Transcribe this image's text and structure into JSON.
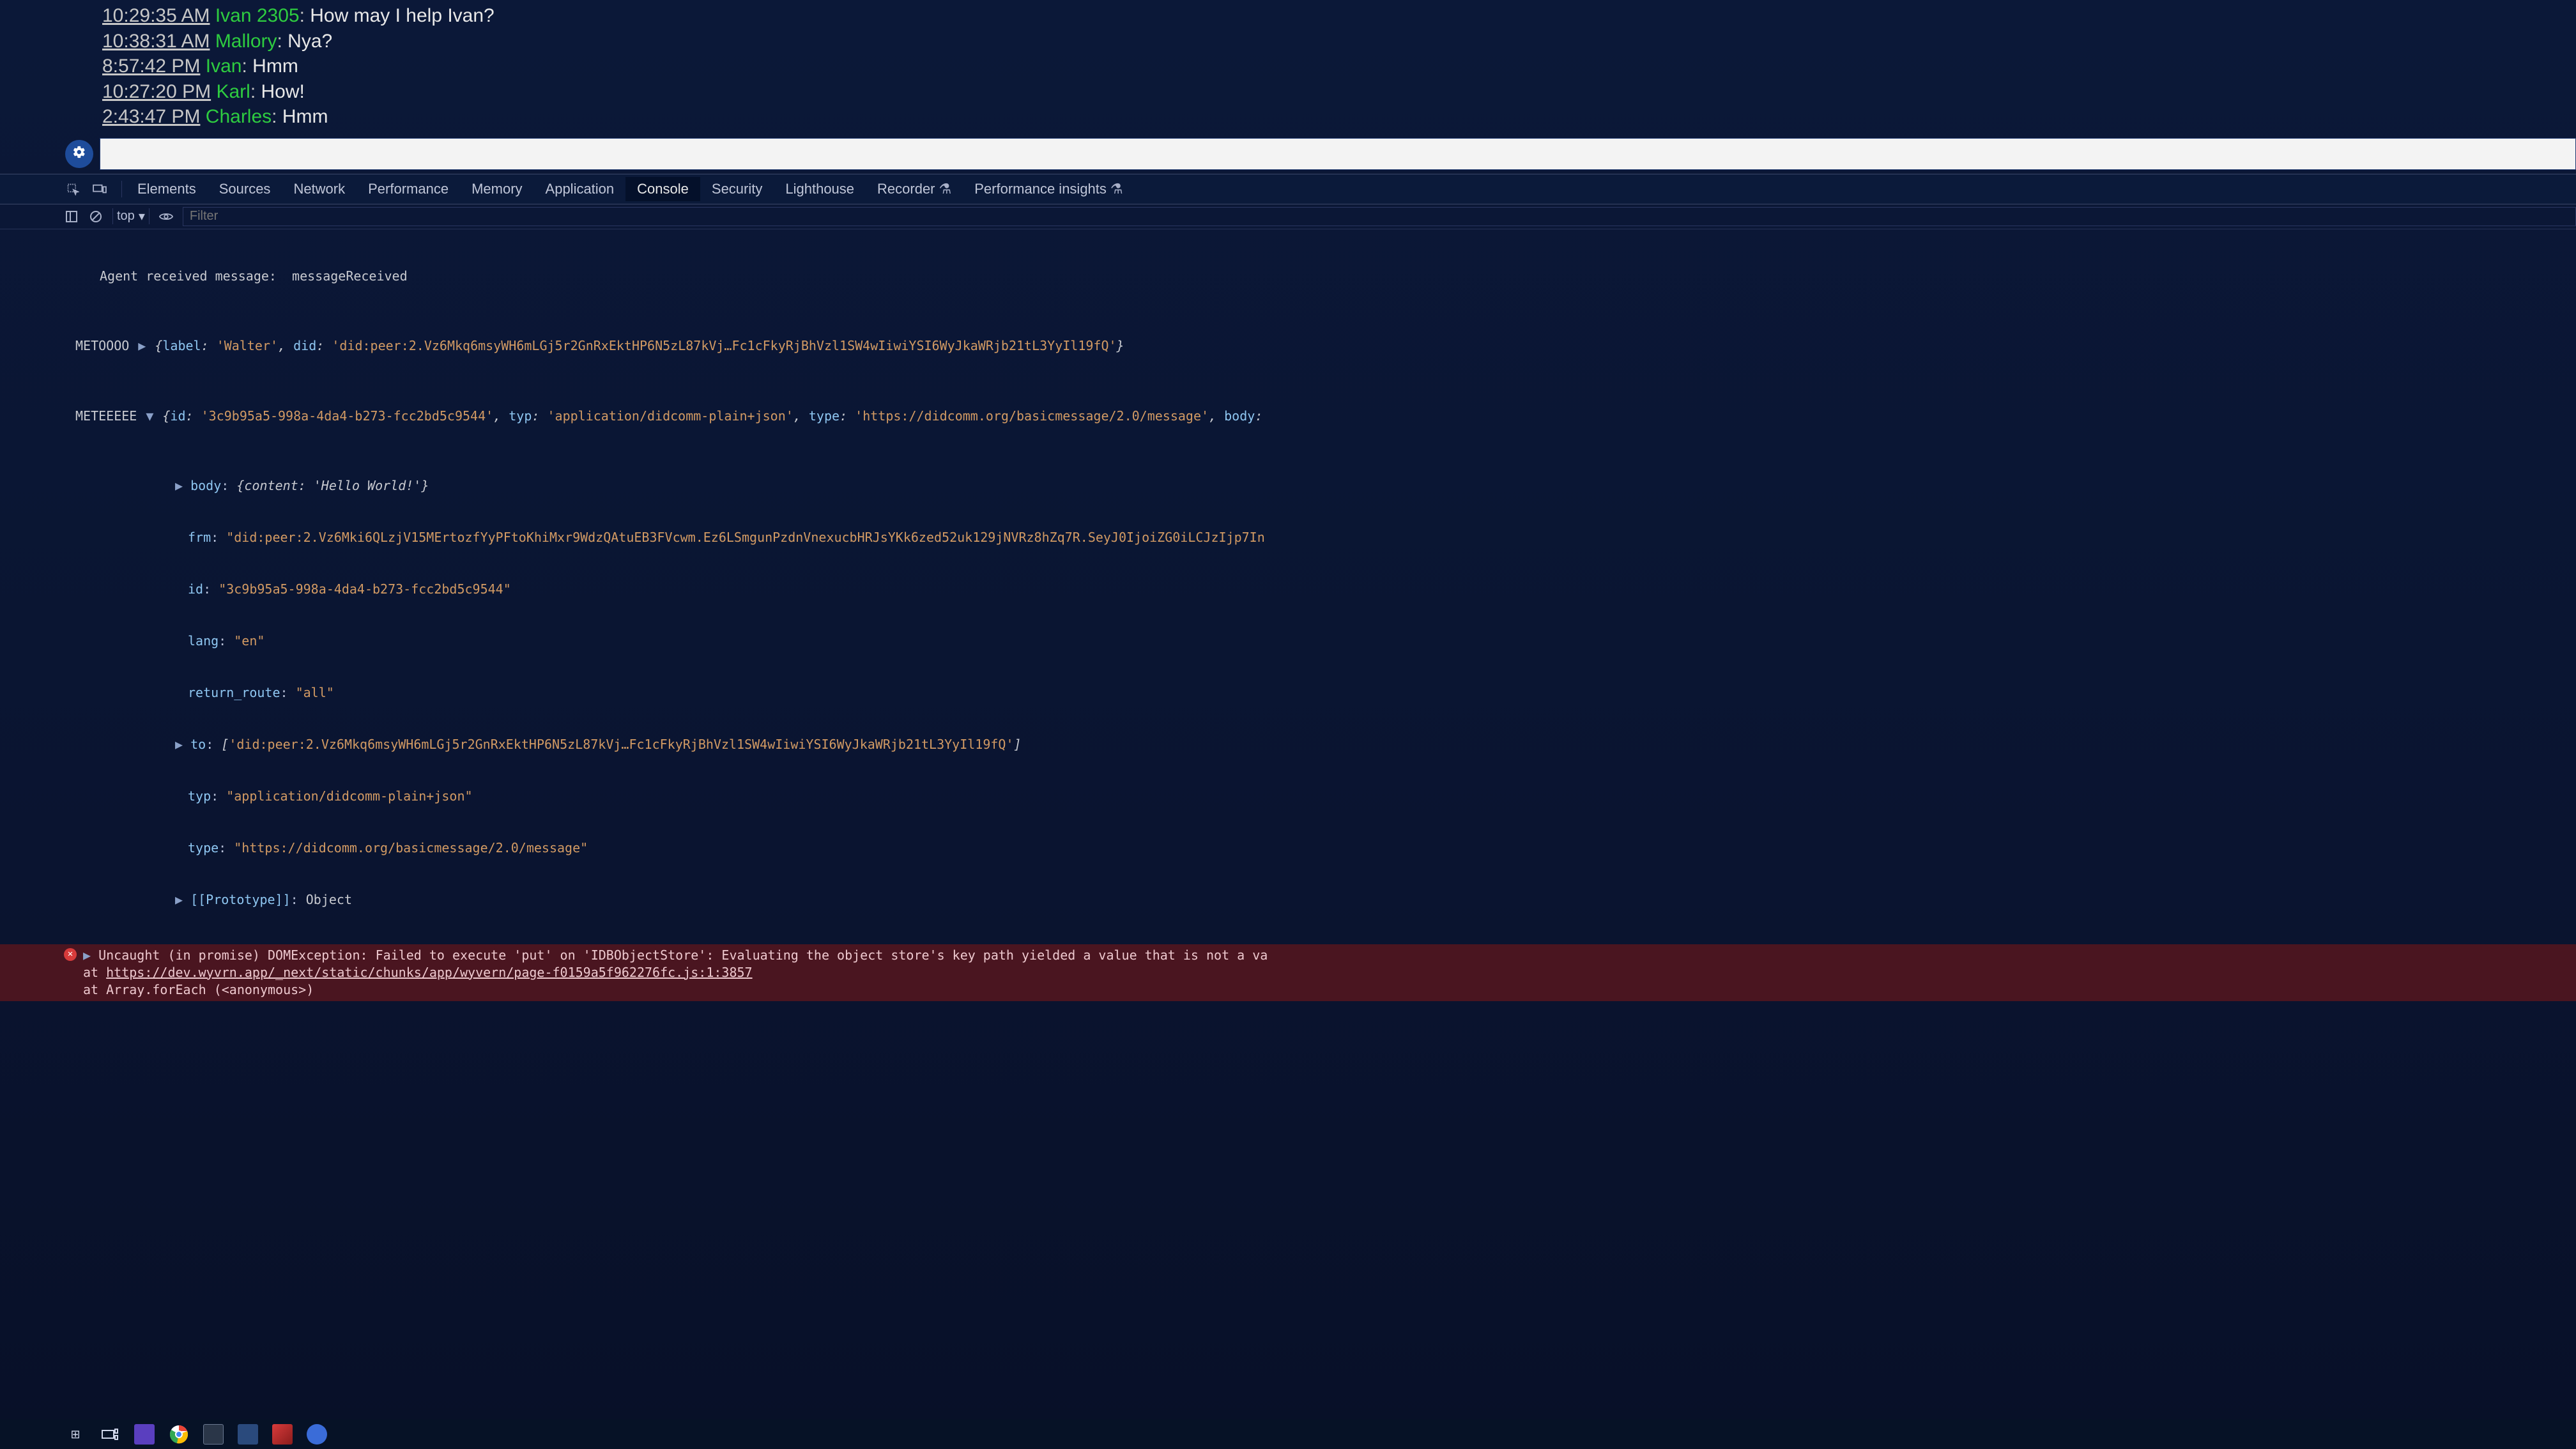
{
  "chat": {
    "messages": [
      {
        "time": "10:29:35 AM",
        "user": "Ivan 2305",
        "text": "How may I help Ivan?"
      },
      {
        "time": "10:38:31 AM",
        "user": "Mallory",
        "text": "Nya?"
      },
      {
        "time": "8:57:42 PM",
        "user": "Ivan",
        "text": "Hmm"
      },
      {
        "time": "10:27:20 PM",
        "user": "Karl",
        "text": "How!"
      },
      {
        "time": "2:43:47 PM",
        "user": "Charles",
        "text": "Hmm"
      }
    ],
    "input_placeholder": ""
  },
  "devtools": {
    "tabs": {
      "elements": "Elements",
      "sources": "Sources",
      "network": "Network",
      "performance": "Performance",
      "memory": "Memory",
      "application": "Application",
      "console": "Console",
      "security": "Security",
      "lighthouse": "Lighthouse",
      "recorder": "Recorder",
      "perf_insights": "Performance insights"
    },
    "toolbar": {
      "context": "top",
      "filter_placeholder": "Filter"
    }
  },
  "console": {
    "line_agent": "Agent received message:  messageReceived",
    "label_metoooo": "METOOOO",
    "metoooo_obj": "{label: 'Walter', did: 'did:peer:2.Vz6Mkq6msyWH6mLGj5r2GnRxEktHP6N5zL87kVj…Fc1cFkyRjBhVzl1SW4wIiwiYSI6WyJkaWRjb21tL3YyIl19fQ'}",
    "label_meteeeee": "METEEEEE",
    "mete_head": "{id: '3c9b95a5-998a-4da4-b273-fcc2bd5c9544', typ: 'application/didcomm-plain+json', type: 'https://didcomm.org/basicmessage/2.0/message', body:",
    "mete_body": "body: {content: 'Hello World!'}",
    "mete_frm": "frm: \"did:peer:2.Vz6Mki6QLzjV15MErtozfYyPFtoKhiMxr9WdzQAtuEB3FVcwm.Ez6LSmgunPzdnVnexucbHRJsYKk6zed52uk129jNVRz8hZq7R.SeyJ0IjoiZG0iLCJzIjp7In",
    "mete_id": "id: \"3c9b95a5-998a-4da4-b273-fcc2bd5c9544\"",
    "mete_lang": "lang: \"en\"",
    "mete_return_route": "return_route: \"all\"",
    "mete_to": "to: ['did:peer:2.Vz6Mkq6msyWH6mLGj5r2GnRxEktHP6N5zL87kVj…Fc1cFkyRjBhVzl1SW4wIiwiYSI6WyJkaWRjb21tL3YyIl19fQ']",
    "mete_typ": "typ: \"application/didcomm-plain+json\"",
    "mete_type": "type: \"https://didcomm.org/basicmessage/2.0/message\"",
    "mete_proto": "[[Prototype]]: Object"
  },
  "error": {
    "line1": "Uncaught (in promise) DOMException: Failed to execute 'put' on 'IDBObjectStore': Evaluating the object store's key path yielded a value that is not a va",
    "line2_prefix": "    at ",
    "line2_link": "https://dev.wyvrn.app/_next/static/chunks/app/wyvern/page-f0159a5f962276fc.js:1:3857",
    "line3": "    at Array.forEach (<anonymous>)"
  },
  "taskbar": {
    "items": [
      "windows",
      "taskview",
      "app1",
      "chrome",
      "app2",
      "app3",
      "app4",
      "app5"
    ]
  }
}
